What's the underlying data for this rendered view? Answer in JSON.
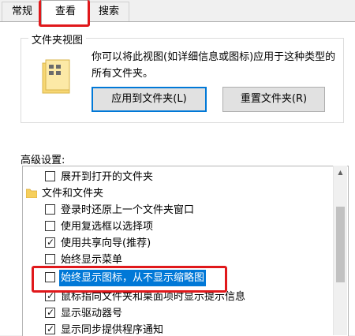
{
  "tabs": [
    {
      "label": "常规"
    },
    {
      "label": "查看"
    },
    {
      "label": "搜索"
    }
  ],
  "folder_views": {
    "title": "文件夹视图",
    "description": "你可以将此视图(如详细信息或图标)应用于这种类型的所有文件夹。",
    "apply_button": "应用到文件夹(L)",
    "reset_button": "重置文件夹(R)"
  },
  "advanced": {
    "label": "高级设置:",
    "items": [
      {
        "label": "展开到打开的文件夹",
        "checked": false
      },
      {
        "label": "文件和文件夹",
        "type": "folder"
      },
      {
        "label": "登录时还原上一个文件夹窗口",
        "checked": false
      },
      {
        "label": "使用复选框以选择项",
        "checked": false
      },
      {
        "label": "使用共享向导(推荐)",
        "checked": true
      },
      {
        "label": "始终显示菜单",
        "checked": false
      },
      {
        "label": "始终显示图标，从不显示缩略图",
        "checked": false,
        "selected": true
      },
      {
        "label": "鼠标指向文件夹和桌面项时显示提示信息",
        "checked": true
      },
      {
        "label": "显示驱动器号",
        "checked": true
      },
      {
        "label": "显示同步提供程序通知",
        "checked": true
      }
    ]
  },
  "colors": {
    "highlight": "#e0181b",
    "selection": "#0078d7"
  }
}
